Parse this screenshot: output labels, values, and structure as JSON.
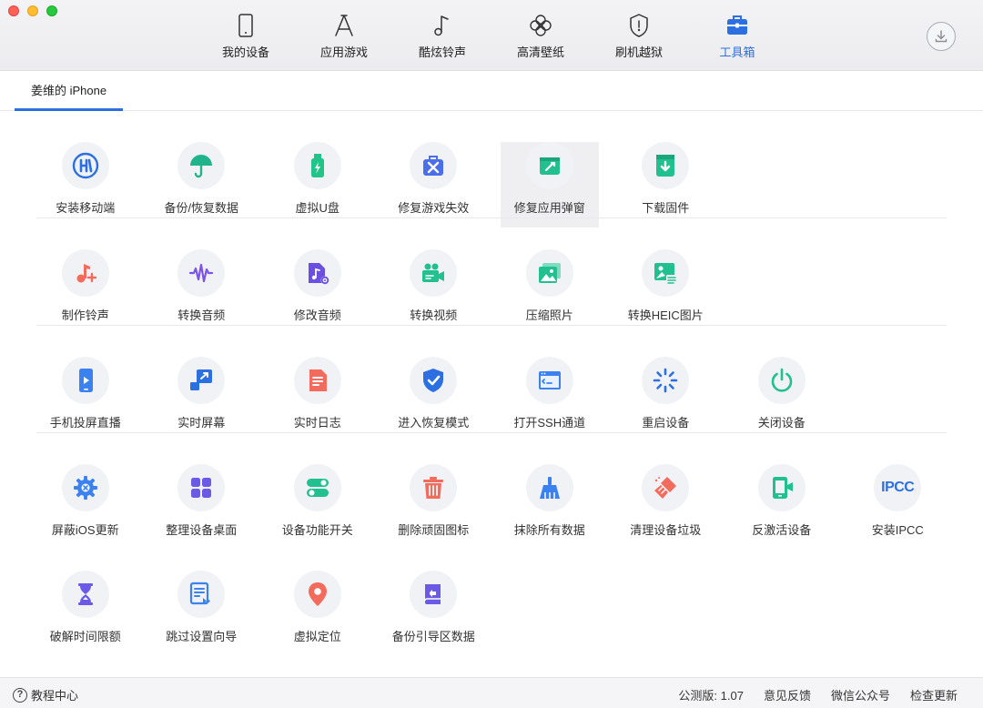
{
  "window": {
    "traffic_lights": [
      "close",
      "minimize",
      "maximize"
    ]
  },
  "nav": {
    "items": [
      {
        "label": "我的设备",
        "icon": "phone-icon"
      },
      {
        "label": "应用游戏",
        "icon": "app-store-icon"
      },
      {
        "label": "酷炫铃声",
        "icon": "music-note-icon"
      },
      {
        "label": "高清壁纸",
        "icon": "flower-icon"
      },
      {
        "label": "刷机越狱",
        "icon": "shield-icon"
      },
      {
        "label": "工具箱",
        "icon": "toolbox-icon"
      }
    ],
    "active_index": 5,
    "active_color": "#2b6fe0",
    "download_icon": "download-icon"
  },
  "device_tab": {
    "label": "姜维的 iPhone"
  },
  "tools": {
    "rows": [
      [
        {
          "label": "安装移动端",
          "icon": "mobile-install-icon",
          "color": "#2b6fe0"
        },
        {
          "label": "备份/恢复数据",
          "icon": "umbrella-icon",
          "color": "#21b48c"
        },
        {
          "label": "虚拟U盘",
          "icon": "usb-drive-icon",
          "color": "#23c48a"
        },
        {
          "label": "修复游戏失效",
          "icon": "repair-kit-icon",
          "color": "#4a6fe8"
        },
        {
          "label": "修复应用弹窗",
          "icon": "app-window-repair-icon",
          "color": "#22c08e"
        },
        {
          "label": "下载固件",
          "icon": "firmware-download-icon",
          "color": "#22c08e"
        }
      ],
      [
        {
          "label": "制作铃声",
          "icon": "ringtone-icon",
          "color": "#f36b5c"
        },
        {
          "label": "转换音频",
          "icon": "waveform-icon",
          "color": "#7c55e6"
        },
        {
          "label": "修改音频",
          "icon": "audio-edit-icon",
          "color": "#6a4fe0"
        },
        {
          "label": "转换视频",
          "icon": "video-camera-icon",
          "color": "#22c08e"
        },
        {
          "label": "压缩照片",
          "icon": "photo-compress-icon",
          "color": "#22c08e"
        },
        {
          "label": "转换HEIC图片",
          "icon": "heic-convert-icon",
          "color": "#22c08e"
        }
      ],
      [
        {
          "label": "手机投屏直播",
          "icon": "screen-cast-icon",
          "color": "#3b82f0"
        },
        {
          "label": "实时屏幕",
          "icon": "realtime-screen-icon",
          "color": "#2b6fe0"
        },
        {
          "label": "实时日志",
          "icon": "log-file-icon",
          "color": "#f36b5c"
        },
        {
          "label": "进入恢复模式",
          "icon": "recovery-shield-icon",
          "color": "#2b6fe0"
        },
        {
          "label": "打开SSH通道",
          "icon": "ssh-terminal-icon",
          "color": "#3b82f0"
        },
        {
          "label": "重启设备",
          "icon": "restart-spinner-icon",
          "color": "#2b6fe0"
        },
        {
          "label": "关闭设备",
          "icon": "power-icon",
          "color": "#22c08e"
        }
      ],
      [
        {
          "label": "屏蔽iOS更新",
          "icon": "block-update-gear-icon",
          "color": "#3b82f0"
        },
        {
          "label": "整理设备桌面",
          "icon": "desktop-grid-icon",
          "color": "#6a5ae6"
        },
        {
          "label": "设备功能开关",
          "icon": "toggle-switch-icon",
          "color": "#22c08e"
        },
        {
          "label": "删除顽固图标",
          "icon": "trash-icon",
          "color": "#f36b5c"
        },
        {
          "label": "抹除所有数据",
          "icon": "broom-icon",
          "color": "#3b82f0"
        },
        {
          "label": "清理设备垃圾",
          "icon": "cleaner-brush-icon",
          "color": "#f36b5c"
        },
        {
          "label": "反激活设备",
          "icon": "deactivate-phone-icon",
          "color": "#22c08e"
        },
        {
          "label": "安装IPCC",
          "icon": "ipcc-icon",
          "color": "#2b6fe0",
          "icon_text": "IPCC"
        }
      ],
      [
        {
          "label": "破解时间限额",
          "icon": "hourglass-icon",
          "color": "#6a5ae6"
        },
        {
          "label": "跳过设置向导",
          "icon": "skip-setup-icon",
          "color": "#3b82f0"
        },
        {
          "label": "虚拟定位",
          "icon": "location-pin-icon",
          "color": "#f36b5c"
        },
        {
          "label": "备份引导区数据",
          "icon": "boot-backup-icon",
          "color": "#6a5ae6"
        }
      ]
    ],
    "highlighted": "修复应用弹窗"
  },
  "footer": {
    "help_label": "教程中心",
    "help_icon": "question-circle-icon",
    "version": "公测版: 1.07",
    "links": [
      "意见反馈",
      "微信公众号",
      "检查更新"
    ]
  }
}
